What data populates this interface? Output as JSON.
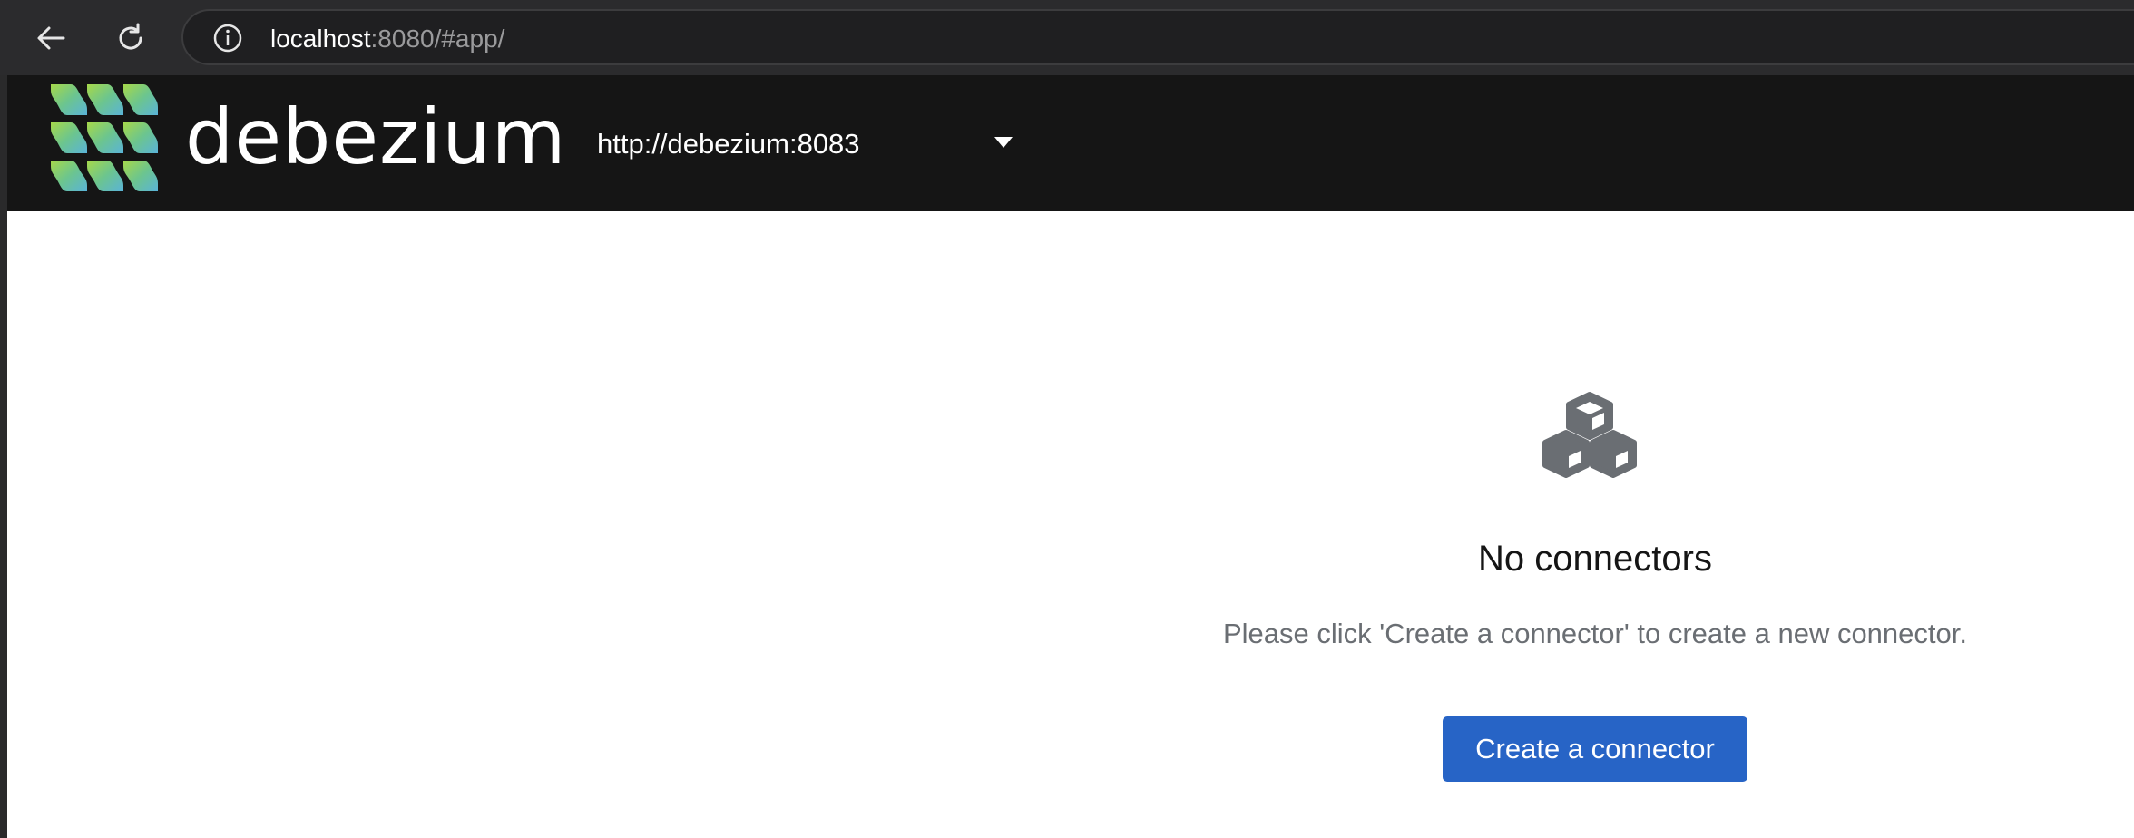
{
  "browser": {
    "url_host": "localhost",
    "url_rest": ":8080/#app/",
    "icons": {
      "back": "back-arrow-icon",
      "reload": "reload-icon",
      "info": "info-icon"
    }
  },
  "header": {
    "brand": "debezium",
    "cluster_url": "http://debezium:8083",
    "logo_colors": [
      "#a6d84a",
      "#6cc58e",
      "#5ab3d8"
    ],
    "background": "#151515"
  },
  "empty_state": {
    "icon": "cubes-icon",
    "title": "No connectors",
    "body": "Please click 'Create a connector' to create a new connector.",
    "button_label": "Create a connector",
    "accent": "#2764c6"
  }
}
